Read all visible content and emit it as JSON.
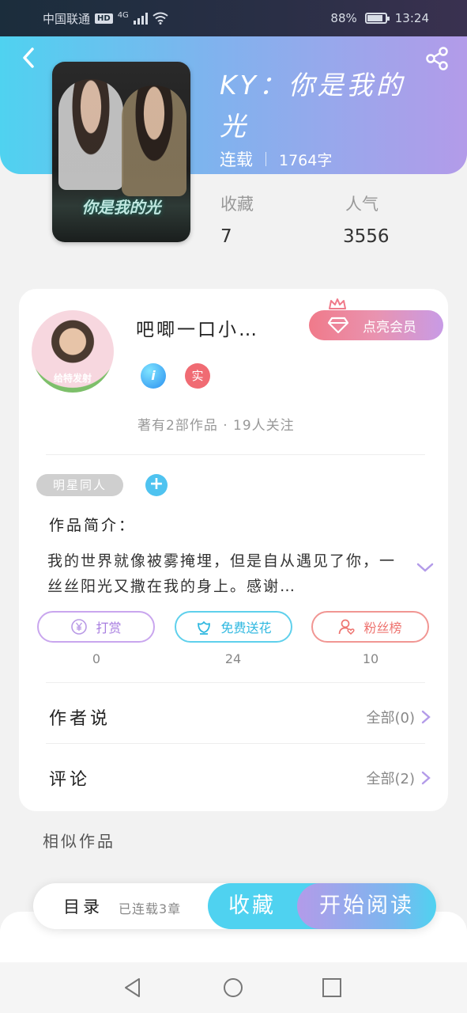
{
  "status_bar": {
    "carrier": "中国联通",
    "hd": "HD",
    "network": "4G",
    "battery": "88%",
    "time": "13:24"
  },
  "book": {
    "title": "KY：你是我的光",
    "status": "连载",
    "word_count": "1764字",
    "favorites_label": "收藏",
    "favorites_value": "7",
    "popularity_label": "人气",
    "popularity_value": "3556",
    "cover_art_title": "你是我的光"
  },
  "author": {
    "name": "吧唧一口小…",
    "avatar_caption": "给特发射",
    "vip_label": "点亮会员",
    "blue_badge": "i",
    "real_badge": "实",
    "meta": "著有2部作品 · 19人关注"
  },
  "tags": {
    "pill": "明星同人",
    "add": "+"
  },
  "intro": {
    "label": "作品简介：",
    "text": "我的世界就像被雾掩埋，但是自从遇见了你，一丝丝阳光又撒在我的身上。感谢…"
  },
  "actions": {
    "reward_label": "打赏",
    "reward_count": "0",
    "flower_label": "免费送花",
    "flower_count": "24",
    "fans_label": "粉丝榜",
    "fans_count": "10"
  },
  "rows": {
    "author_says": "作者说",
    "author_says_right": "全部(0)",
    "comments": "评论",
    "comments_right": "全部(2)"
  },
  "similar_label": "相似作品",
  "bottom_bar": {
    "toc": "目录",
    "chapters": "已连载3章",
    "collect": "收藏",
    "read": "开始阅读"
  },
  "colors": {
    "accent_cyan": "#4fd2f0",
    "accent_purple": "#b39be9",
    "vip_pink": "#f07a8a"
  }
}
